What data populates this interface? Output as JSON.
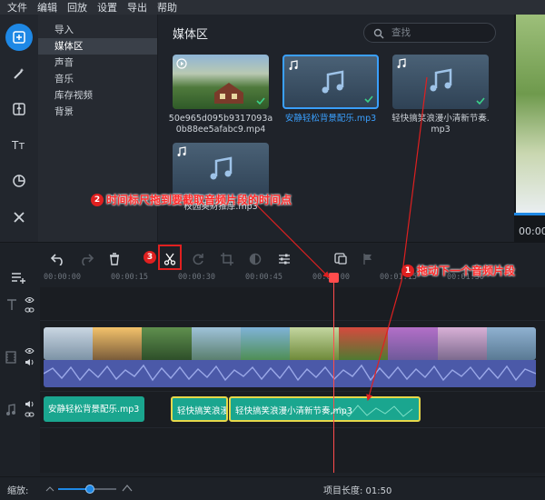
{
  "menu": [
    "文件",
    "编辑",
    "回放",
    "设置",
    "导出",
    "帮助"
  ],
  "nav": {
    "items": [
      "导入",
      "媒体区",
      "声音",
      "音乐",
      "库存视频",
      "背景"
    ],
    "active_index": 1
  },
  "media": {
    "title": "媒体区",
    "search_placeholder": "查找",
    "tiles": [
      {
        "caption": "50e965d095b9317093a0b88ee5afabc9.mp4",
        "kind": "video",
        "checked": true
      },
      {
        "caption": "安静轻松背景配乐.mp3",
        "kind": "audio",
        "checked": true,
        "selected": true
      },
      {
        "caption": "轻快搞笑浪漫小清新节奏.mp3",
        "kind": "audio",
        "checked": true
      },
      {
        "caption": "校园奥财推摩.mp3",
        "kind": "audio",
        "checked": false
      }
    ]
  },
  "preview": {
    "time": "00:00"
  },
  "ruler": {
    "labels": [
      "00:00:00",
      "00:00:15",
      "00:00:30",
      "00:00:45",
      "00:01:00",
      "00:01:15",
      "00:01:30"
    ]
  },
  "timeline": {
    "clips": [
      {
        "label": "安静轻松背景配乐.mp3"
      },
      {
        "label": "轻快搞笑浪漫"
      },
      {
        "label": "轻快搞笑浪漫小清新节奏.mp3"
      }
    ]
  },
  "status": {
    "zoom_label": "缩放:",
    "zoom_level": 0.55,
    "project_length": "项目长度: 01:50"
  },
  "annotations": [
    {
      "num": "1",
      "text": "拖动下一个音频片段"
    },
    {
      "num": "2",
      "text": "时间标尺拖到要截取音频片段的时间点"
    },
    {
      "num": "3",
      "text": ""
    }
  ],
  "colors": {
    "accent": "#1e88e5",
    "clip": "#1aa68f",
    "clip_highlight": "#e6d84a",
    "playhead": "#ff4c4c",
    "annotation": "#e02020"
  }
}
